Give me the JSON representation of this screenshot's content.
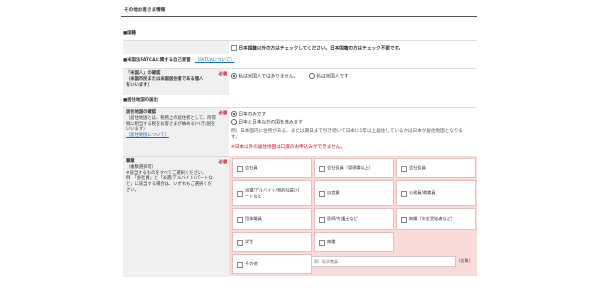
{
  "header": {
    "title": "その他お客さま情報"
  },
  "nationality": {
    "section": "■国籍",
    "checkbox_label": "日本国籍以外の方はチェックしてください。日本国籍の方はチェック不要です。"
  },
  "fatca": {
    "section_prefix": "■米国法FATCAに関する自己宣誓",
    "link": "（FATCAについて）",
    "label_title": "「米国人」の確認",
    "label_sub": "（米国市民または米国居住者である個人をいいます）",
    "required": "必須",
    "opt_no": "私は米国人ではありません。",
    "opt_yes": "私は米国人です"
  },
  "residence": {
    "section": "■居住地国の届出",
    "label_title": "居住地国の確認",
    "label_sub": "（居住地国とは、税務上の居住者として、所得税に相当する税をお客さまが納める(べき)国をいいます）",
    "link": "（居住地国について）",
    "required": "必須",
    "opt_japan": "日本のみです",
    "opt_other": "日本と日本以外の国を含みます",
    "example": "例）日本国内に住所がある、または期日まで引き続いて日本に1年以上居住しているかは日本が居住地国となります。",
    "warning": "※日本以外の居住地国は口座のお申込みができません。"
  },
  "occupation": {
    "label_title": "職業",
    "label_sub1": "（複数選択可）",
    "label_sub2": "※該当するものをすべてご選択ください。",
    "label_sub3": "例　「会社員」と「派遣/アルバイト/パートなど」に該当する場合は、いずれもご選択ください。",
    "required": "必須",
    "options": [
      "会社員",
      "会社役員（管理職以上）",
      "会社役員",
      "派遣/アルバイト/契約社員/パートなど",
      "自営業",
      "公務員/教職員",
      "団体職員",
      "医師/弁護士など",
      "無職（年金受給者など）",
      "学生",
      "無職",
      "その他"
    ],
    "other_placeholder": "例）私学教員",
    "other_unit": "（全角）"
  },
  "colors": {
    "accent_red": "#d0021b",
    "grid_bg": "#fbdada",
    "link_blue": "#1a6ad6"
  }
}
